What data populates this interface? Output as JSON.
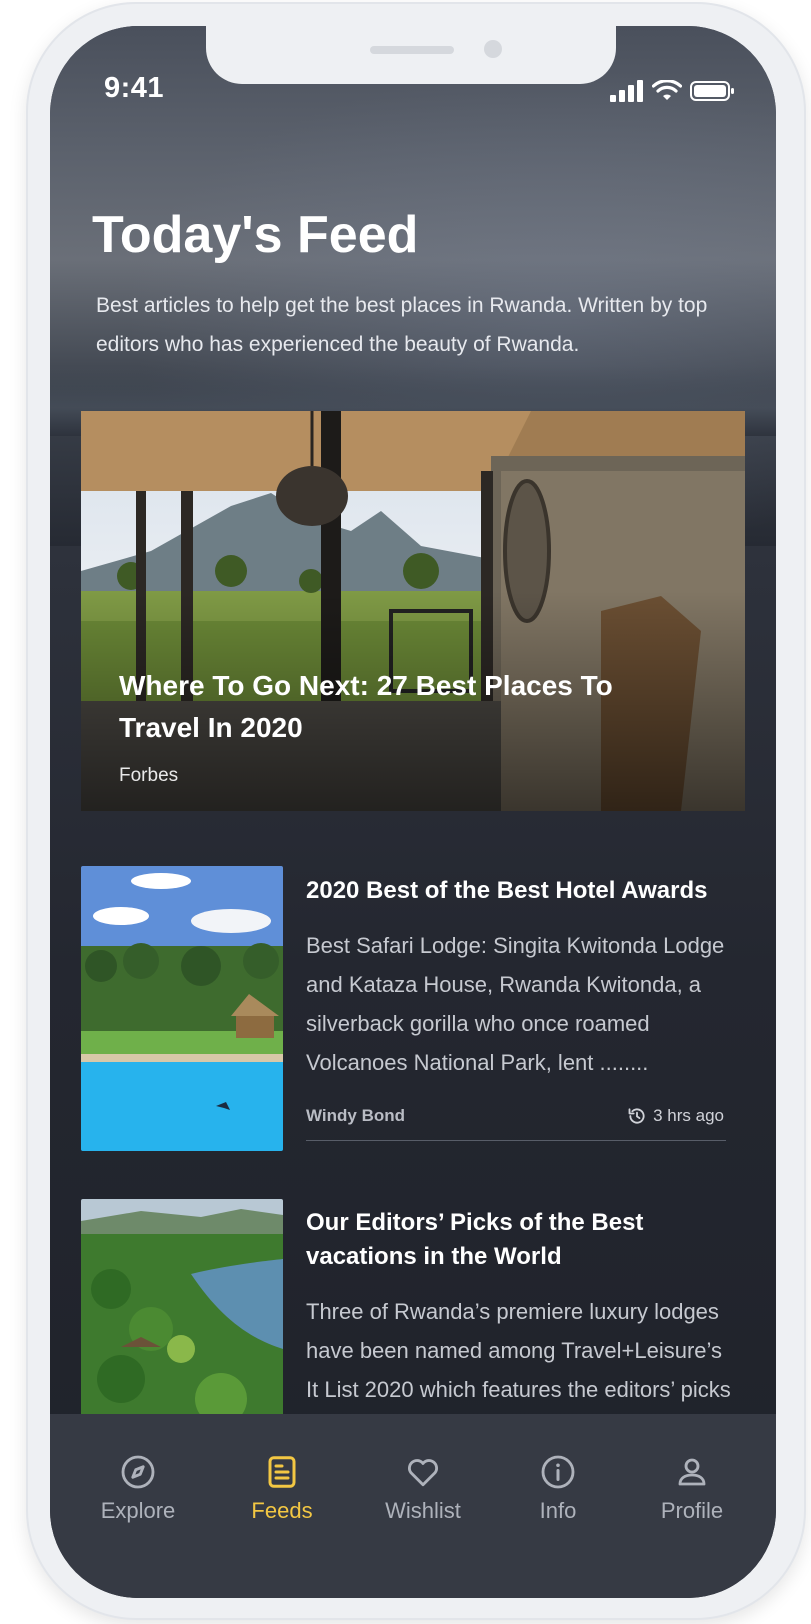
{
  "status_bar": {
    "time": "9:41"
  },
  "header": {
    "title": "Today's Feed",
    "subtitle": "Best articles to help get the best places in Rwanda. Written by top editors who has experienced the beauty of Rwanda."
  },
  "featured": {
    "title": "Where To Go Next: 27 Best Places To Travel In 2020",
    "source": "Forbes"
  },
  "articles": [
    {
      "title": "2020 Best of the Best Hotel Awards",
      "excerpt": "Best Safari Lodge: Singita Kwitonda Lodge and Kataza House, Rwanda Kwitonda, a silverback gorilla who once roamed Volcanoes National Park, lent ........",
      "author": "Windy Bond",
      "time": "3 hrs ago"
    },
    {
      "title": "Our Editors’ Picks of the Best vacations in the World",
      "excerpt": "Three of Rwanda’s premiere luxury lodges have been named among Travel+Leisure’s It List 2020 which features the editors’ picks of the best new hotels in the wo........"
    }
  ],
  "tabbar": {
    "tabs": [
      {
        "label": "Explore",
        "icon": "compass-icon"
      },
      {
        "label": "Feeds",
        "icon": "document-icon",
        "active": true
      },
      {
        "label": "Wishlist",
        "icon": "heart-icon"
      },
      {
        "label": "Info",
        "icon": "info-icon"
      },
      {
        "label": "Profile",
        "icon": "user-icon"
      }
    ]
  },
  "colors": {
    "accent": "#f3c743",
    "tabbar_bg": "#363a44",
    "screen_bg": "#242730"
  }
}
